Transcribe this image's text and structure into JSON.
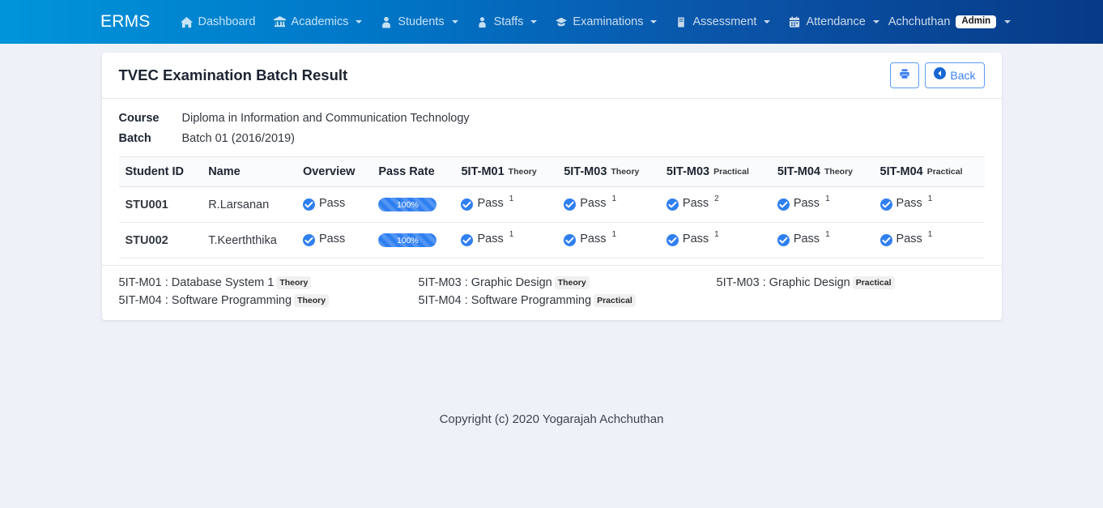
{
  "navbar": {
    "brand": "ERMS",
    "items": [
      {
        "label": "Dashboard",
        "icon": "home-icon",
        "caret": false
      },
      {
        "label": "Academics",
        "icon": "bank-icon",
        "caret": true
      },
      {
        "label": "Students",
        "icon": "user-tie-icon",
        "caret": true
      },
      {
        "label": "Staffs",
        "icon": "user-icon",
        "caret": true
      },
      {
        "label": "Examinations",
        "icon": "graduation-icon",
        "caret": true
      },
      {
        "label": "Assessment",
        "icon": "book-icon",
        "caret": true
      },
      {
        "label": "Attendance",
        "icon": "calendar-icon",
        "caret": true
      }
    ],
    "user": {
      "name": "Achchuthan",
      "role_badge": "Admin"
    },
    "colors": {
      "gradient_start": "#0095da",
      "gradient_end": "#073a87"
    }
  },
  "card": {
    "title": "TVEC Examination Batch Result",
    "actions": {
      "print_label": "",
      "back_label": "Back"
    },
    "info": [
      {
        "label": "Course",
        "value": "Diploma in Information and Communication Technology"
      },
      {
        "label": "Batch",
        "value": "Batch 01 (2016/2019)"
      }
    ]
  },
  "table": {
    "columns": [
      {
        "title": "Student ID",
        "sub": ""
      },
      {
        "title": "Name",
        "sub": ""
      },
      {
        "title": "Overview",
        "sub": ""
      },
      {
        "title": "Pass Rate",
        "sub": ""
      },
      {
        "title": "5IT-M01",
        "sub": "Theory"
      },
      {
        "title": "5IT-M03",
        "sub": "Theory"
      },
      {
        "title": "5IT-M03",
        "sub": "Practical"
      },
      {
        "title": "5IT-M04",
        "sub": "Theory"
      },
      {
        "title": "5IT-M04",
        "sub": "Practical"
      }
    ],
    "rows": [
      {
        "student_id": "STU001",
        "name": "R.Larsanan",
        "overview": {
          "status": "Pass",
          "attempts": ""
        },
        "pass_rate": "100%",
        "pass_rate_value": 100,
        "modules": [
          {
            "status": "Pass",
            "attempts": "1"
          },
          {
            "status": "Pass",
            "attempts": "1"
          },
          {
            "status": "Pass",
            "attempts": "2"
          },
          {
            "status": "Pass",
            "attempts": "1"
          },
          {
            "status": "Pass",
            "attempts": "1"
          }
        ]
      },
      {
        "student_id": "STU002",
        "name": "T.Keerththika",
        "overview": {
          "status": "Pass",
          "attempts": ""
        },
        "pass_rate": "100%",
        "pass_rate_value": 100,
        "modules": [
          {
            "status": "Pass",
            "attempts": "1"
          },
          {
            "status": "Pass",
            "attempts": "1"
          },
          {
            "status": "Pass",
            "attempts": "1"
          },
          {
            "status": "Pass",
            "attempts": "1"
          },
          {
            "status": "Pass",
            "attempts": "1"
          }
        ]
      }
    ]
  },
  "legend": [
    {
      "code": "5IT-M01",
      "name": "Database System 1",
      "tag": "Theory"
    },
    {
      "code": "5IT-M03",
      "name": "Graphic Design",
      "tag": "Theory"
    },
    {
      "code": "5IT-M03",
      "name": "Graphic Design",
      "tag": "Practical"
    },
    {
      "code": "5IT-M04",
      "name": "Software Programming",
      "tag": "Theory"
    },
    {
      "code": "5IT-M04",
      "name": "Software Programming",
      "tag": "Practical"
    }
  ],
  "footer": {
    "copyright": "Copyright (c) 2020 Yogarajah Achchuthan"
  }
}
